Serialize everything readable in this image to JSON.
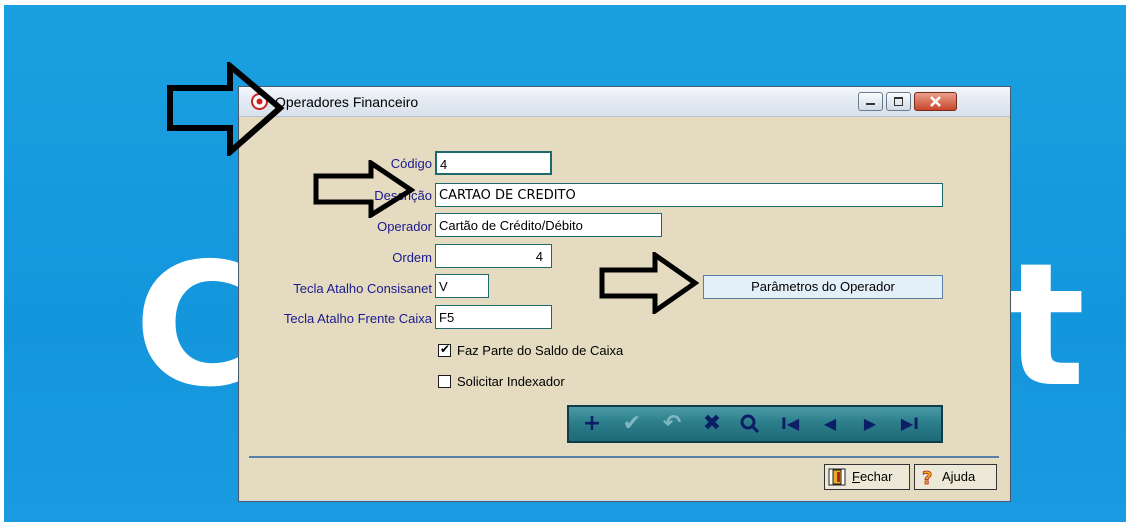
{
  "background": {
    "brand_letter_left": "C",
    "brand_letter_right": "t"
  },
  "window": {
    "title": "Operadores Financeiro",
    "controls": {
      "minimize": "minimize",
      "maximize": "maximize",
      "close": "close"
    }
  },
  "form": {
    "codigo": {
      "label": "Código",
      "value": "4"
    },
    "descricao": {
      "label": "Descrição",
      "value": "CARTAO DE CREDITO"
    },
    "operador": {
      "label": "Operador",
      "value": "Cartão de Crédito/Débito"
    },
    "ordem": {
      "label": "Ordem",
      "value": "4"
    },
    "tecla_consisanet": {
      "label": "Tecla Atalho Consisanet",
      "value": "V"
    },
    "tecla_frente_caixa": {
      "label": "Tecla Atalho Frente Caixa",
      "value": "F5"
    },
    "params_button": "Parâmetros do Operador",
    "faz_parte": {
      "label": "Faz Parte do Saldo de Caixa",
      "checked": true
    },
    "solicitar": {
      "label": "Solicitar Indexador",
      "checked": false
    }
  },
  "navigator": {
    "buttons": [
      {
        "name": "add",
        "glyph": "+",
        "enabled": true
      },
      {
        "name": "confirm",
        "glyph": "✔",
        "enabled": false
      },
      {
        "name": "undo",
        "glyph": "↶",
        "enabled": false
      },
      {
        "name": "delete",
        "glyph": "✖",
        "enabled": true
      },
      {
        "name": "search",
        "glyph": "⚲",
        "enabled": true
      },
      {
        "name": "first",
        "glyph": "I◀",
        "enabled": true
      },
      {
        "name": "prior",
        "glyph": "◀",
        "enabled": true
      },
      {
        "name": "next",
        "glyph": "▶",
        "enabled": true
      },
      {
        "name": "last",
        "glyph": "▶I",
        "enabled": true
      }
    ]
  },
  "footer": {
    "fechar": {
      "accel": "F",
      "rest": "echar"
    },
    "ajuda": "Ajuda"
  },
  "colors": {
    "desktop": "#1aa0e0",
    "window_body": "#e4dbc1",
    "navigator": "#2d7e8b",
    "label": "#1a1a8c"
  }
}
